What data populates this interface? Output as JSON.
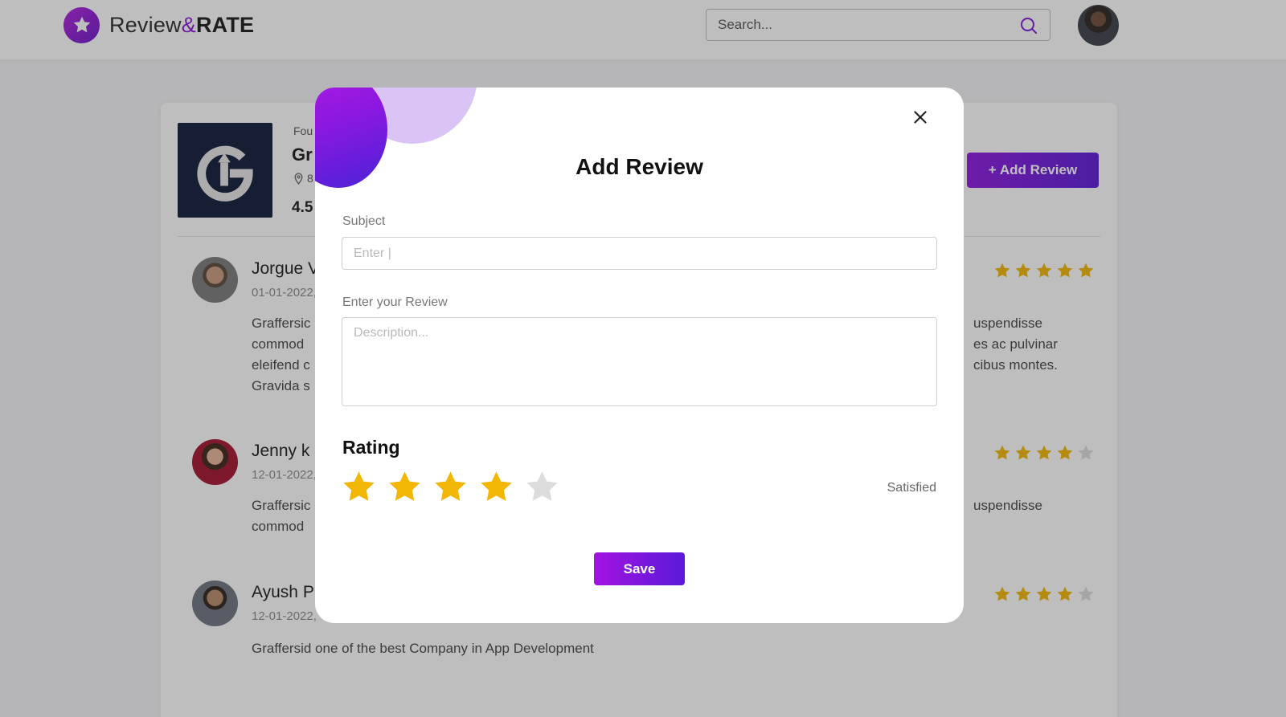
{
  "header": {
    "logo_text_a": "Review",
    "logo_text_amp": "&",
    "logo_text_b": "RATE",
    "search_placeholder": "Search..."
  },
  "company": {
    "small_label": "Fou",
    "name": "Gr",
    "location": "8",
    "rating": "4.5",
    "add_review_label": "+ Add Review"
  },
  "reviews": [
    {
      "name": "Jorgue V",
      "date": "01-01-2022,",
      "text_left": "Graffersic\ncommod\neleifend c\nGravida s",
      "text_right": "uspendisse\nes ac pulvinar\ncibus montes.",
      "stars": 5
    },
    {
      "name": "Jenny k",
      "date": "12-01-2022,",
      "text_left": "Graffersic\ncommod",
      "text_right": "uspendisse",
      "stars": 4
    },
    {
      "name": "Ayush P",
      "date": "12-01-2022,",
      "text_full": "Graffersid one of the best Company in App Development",
      "stars": 4
    }
  ],
  "modal": {
    "title": "Add Review",
    "subject_label": "Subject",
    "subject_placeholder": "Enter |",
    "review_label": "Enter your Review",
    "review_placeholder": "Description...",
    "rating_label": "Rating",
    "rating_value": 4,
    "rating_max": 5,
    "rating_text": "Satisfied",
    "save_label": "Save"
  },
  "colors": {
    "accent_purple": "#8b17e0",
    "star_gold": "#f2b705",
    "star_empty": "#dcdcdc"
  }
}
